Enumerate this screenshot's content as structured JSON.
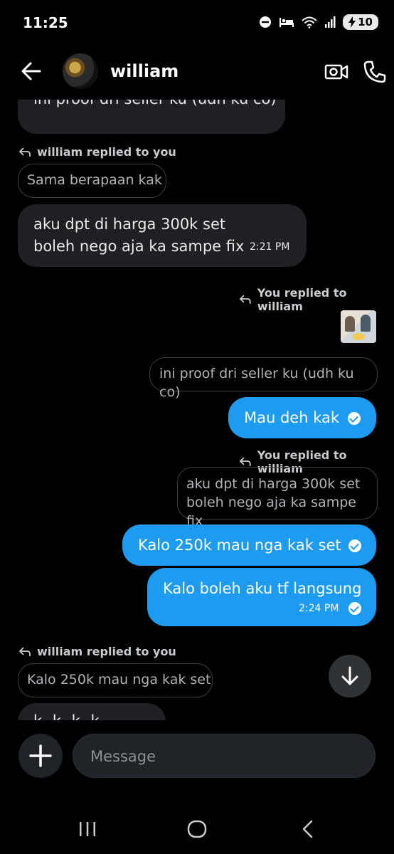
{
  "status_bar": {
    "time": "11:25",
    "battery": "10"
  },
  "header": {
    "contact_name": "william"
  },
  "messages": {
    "m1_text": "ini proof dri seller ku (udh ku co)",
    "m2_reply_note": "william replied to you",
    "m2_quote": "Sama berapaan kak",
    "m2_line1": "aku dpt di harga 300k set",
    "m2_line2": "boleh nego aja ka sampe fix",
    "m2_time": "2:21 PM",
    "m3_reply_note": "You replied to william",
    "m3_quote": "ini proof dri seller ku (udh ku co)",
    "m3_text": "Mau deh kak",
    "m4_reply_note": "You replied to william",
    "m4_quote_line1": "aku dpt di harga 300k set",
    "m4_quote_line2": "boleh nego aja ka sampe fix",
    "m4_text": "Kalo 250k mau nga kak set",
    "m5_text": "Kalo boleh aku tf langsung",
    "m5_time": "2:24 PM",
    "m6_reply_note": "william replied to you",
    "m6_quote": "Kalo 250k mau nga kak set",
    "m6_partial": "k k k k"
  },
  "composer": {
    "placeholder": "Message"
  },
  "colors": {
    "accent": "#1d9bf0",
    "incoming_bubble": "#1e2023",
    "background": "#000000"
  }
}
